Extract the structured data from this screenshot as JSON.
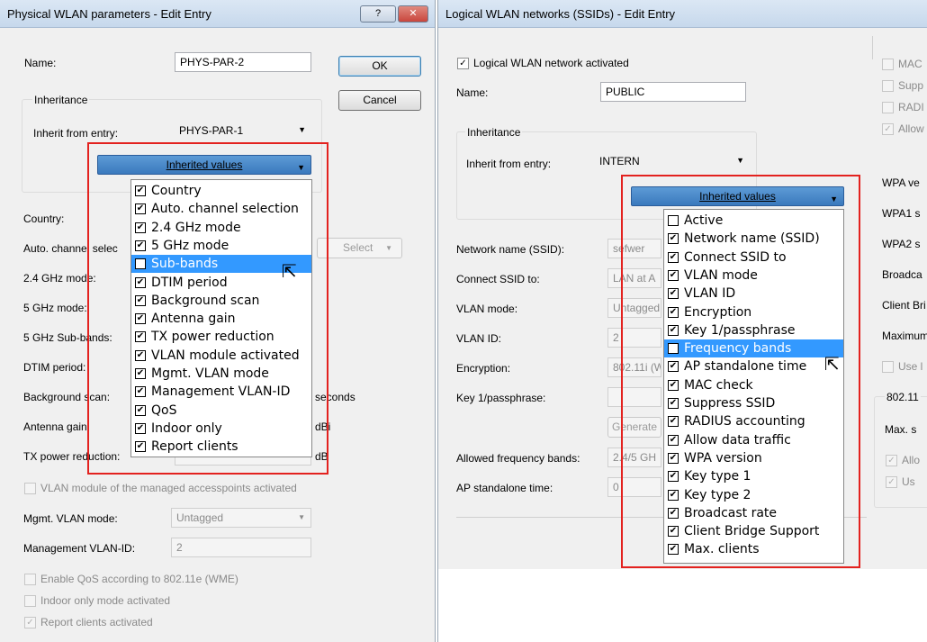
{
  "left_dialog": {
    "title": "Physical WLAN parameters - Edit Entry",
    "help_btn": "?",
    "close_btn": "✕",
    "name_label": "Name:",
    "name_value": "PHYS-PAR-2",
    "ok": "OK",
    "cancel": "Cancel",
    "inheritance_label": "Inheritance",
    "inherit_from_label": "Inherit from entry:",
    "inherit_from_value": "PHYS-PAR-1",
    "inherited_values_btn": "Inherited values",
    "country_label": "Country:",
    "auto_channel_label": "Auto. channel selec",
    "select_btn": "Select",
    "ghz24_label": "2.4 GHz mode:",
    "ghz5_label": "5 GHz mode:",
    "subbands_label": "5 GHz Sub-bands:",
    "dtim_label": "DTIM period:",
    "bgscan_label": "Background scan:",
    "bgscan_unit": "seconds",
    "antenna_label": "Antenna gain:",
    "antenna_unit": "dBi",
    "txpower_label": "TX power reduction:",
    "txpower_unit": "dB",
    "vlan_module_cb": "VLAN module of the managed accesspoints activated",
    "mgmt_vlan_mode_label": "Mgmt. VLAN mode:",
    "mgmt_vlan_mode_value": "Untagged",
    "mgmt_vlan_id_label": "Management VLAN-ID:",
    "mgmt_vlan_id_value": "2",
    "qos_cb": "Enable QoS according to 802.11e (WME)",
    "indoor_cb": "Indoor only mode activated",
    "report_cb": "Report clients activated",
    "popup_items": [
      {
        "label": "Country",
        "checked": true
      },
      {
        "label": "Auto. channel selection",
        "checked": true
      },
      {
        "label": "2.4 GHz mode",
        "checked": true
      },
      {
        "label": "5 GHz mode",
        "checked": true
      },
      {
        "label": "Sub-bands",
        "checked": true,
        "selected": true
      },
      {
        "label": "DTIM period",
        "checked": true
      },
      {
        "label": "Background scan",
        "checked": true
      },
      {
        "label": "Antenna gain",
        "checked": true
      },
      {
        "label": "TX power reduction",
        "checked": true
      },
      {
        "label": "VLAN module activated",
        "checked": true
      },
      {
        "label": "Mgmt. VLAN mode",
        "checked": true
      },
      {
        "label": "Management VLAN-ID",
        "checked": true
      },
      {
        "label": "QoS",
        "checked": true
      },
      {
        "label": "Indoor only",
        "checked": true
      },
      {
        "label": "Report clients",
        "checked": true
      }
    ]
  },
  "right_dialog": {
    "title": "Logical WLAN networks (SSIDs) - Edit Entry",
    "activated_cb": "Logical WLAN network activated",
    "name_label": "Name:",
    "name_value": "PUBLIC",
    "inheritance_label": "Inheritance",
    "inherit_from_label": "Inherit from entry:",
    "inherit_from_value": "INTERN",
    "inherited_values_btn": "Inherited values",
    "ssid_label": "Network name (SSID):",
    "ssid_value": "sefwer",
    "connect_label": "Connect SSID to:",
    "connect_value": "LAN at A",
    "vlan_mode_label": "VLAN mode:",
    "vlan_mode_value": "Untagged",
    "vlan_id_label": "VLAN ID:",
    "vlan_id_value": "2",
    "encryption_label": "Encryption:",
    "encryption_value": "802.11i (W",
    "key_label": "Key 1/passphrase:",
    "generate_btn": "Generate",
    "freq_label": "Allowed frequency bands:",
    "freq_value": "2.4/5 GH",
    "ap_label": "AP standalone time:",
    "ap_value": "0",
    "right_col": {
      "mac_cb": "MAC",
      "supp_cb": "Supp",
      "radi_cb": "RADI",
      "allow_cb": "Allow",
      "wpa_ver": "WPA ve",
      "wpa1": "WPA1 s",
      "wpa2": "WPA2 s",
      "broadca": "Broadca",
      "client_br": "Client Bri",
      "maximum": "Maximum",
      "use_cb": "Use l",
      "dot11": "802.11",
      "max_s": "Max. s",
      "allo_cb": "Allo",
      "us_cb": "Us"
    },
    "popup_items": [
      {
        "label": "Active",
        "checked": false
      },
      {
        "label": "Network name (SSID)",
        "checked": true
      },
      {
        "label": "Connect SSID to",
        "checked": true
      },
      {
        "label": "VLAN mode",
        "checked": true
      },
      {
        "label": "VLAN ID",
        "checked": true
      },
      {
        "label": "Encryption",
        "checked": true
      },
      {
        "label": "Key 1/passphrase",
        "checked": true
      },
      {
        "label": "Frequency bands",
        "checked": true,
        "selected": true
      },
      {
        "label": "AP standalone time",
        "checked": true
      },
      {
        "label": "MAC check",
        "checked": true
      },
      {
        "label": "Suppress SSID",
        "checked": true
      },
      {
        "label": "RADIUS accounting",
        "checked": true
      },
      {
        "label": "Allow data traffic",
        "checked": true
      },
      {
        "label": "WPA version",
        "checked": true
      },
      {
        "label": "Key type 1",
        "checked": true
      },
      {
        "label": "Key type 2",
        "checked": true
      },
      {
        "label": "Broadcast rate",
        "checked": true
      },
      {
        "label": "Client Bridge Support",
        "checked": true
      },
      {
        "label": "Max. clients",
        "checked": true
      }
    ]
  },
  "colors": {
    "highlight": "#3399ff",
    "annotation": "#e3221f",
    "close_button": "#c9463d"
  }
}
